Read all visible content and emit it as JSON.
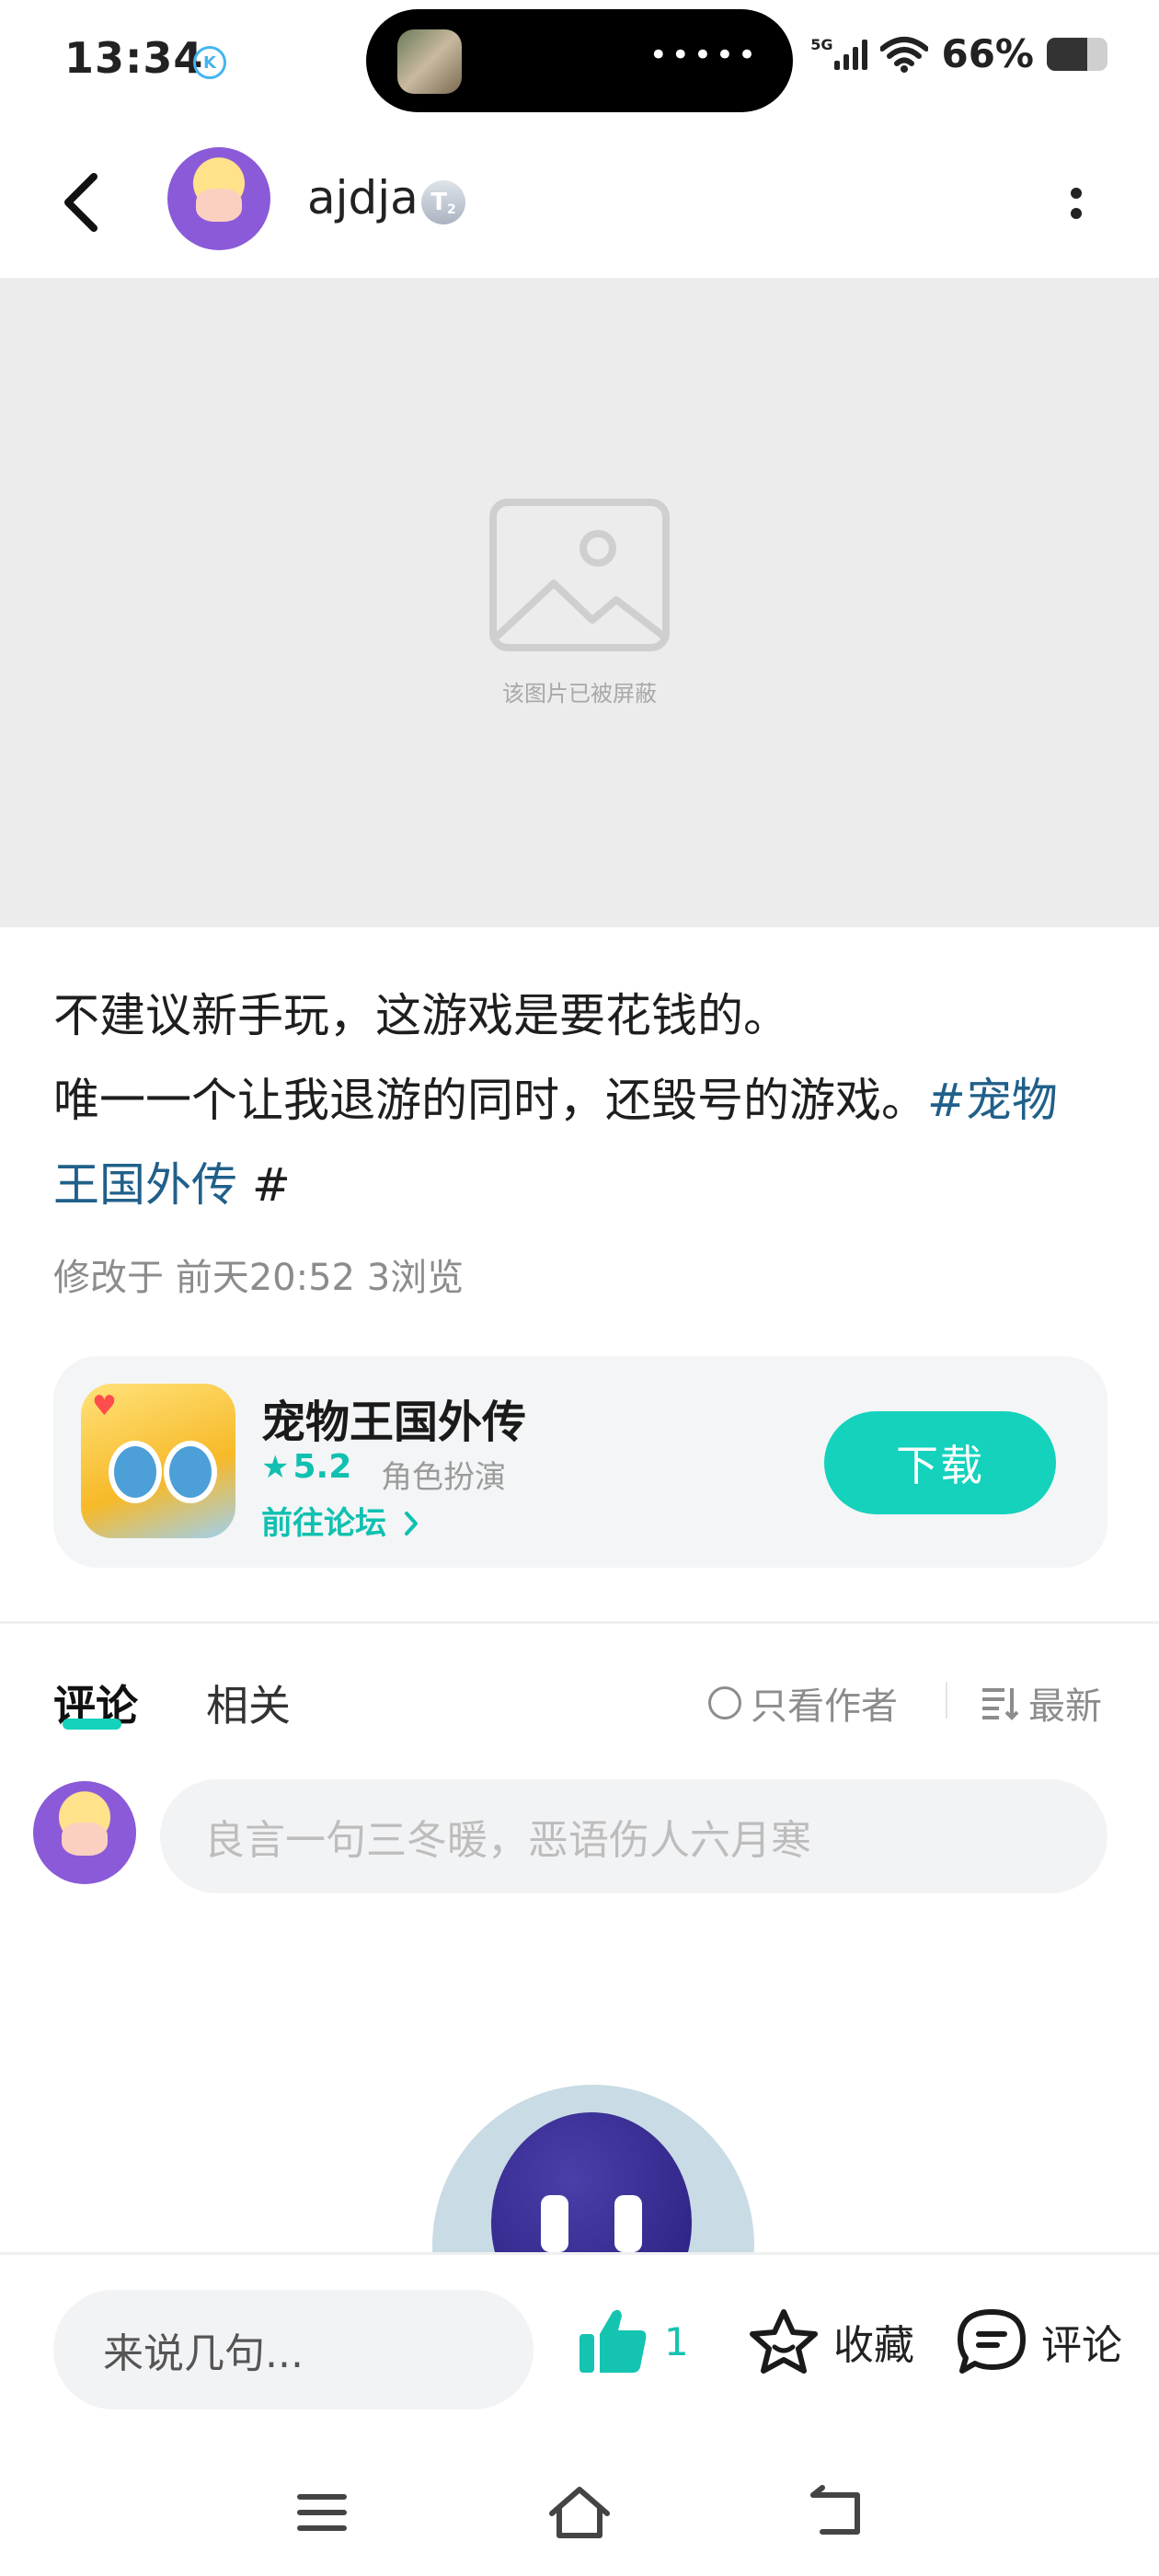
{
  "status_bar": {
    "time": "13:34",
    "k_badge": "K",
    "network": "5G",
    "battery_percent_text": "66%",
    "battery_level": 0.66
  },
  "header": {
    "author_name": "ajdja",
    "level_badge": "T",
    "level_sub": "2"
  },
  "image": {
    "caption": "该图片已被屏蔽"
  },
  "post": {
    "line1": "不建议新手玩，这游戏是要花钱的。",
    "line2_text": "唯一一个让我退游的同时，还毁号的游戏。",
    "line2_topic": "#宠物",
    "line3_topic": "王国外传",
    "line3_hash": " #",
    "meta": "修改于 前天20:52  3浏览"
  },
  "game_card": {
    "title": "宠物王国外传",
    "rating": "5.2",
    "genre": "角色扮演",
    "forum_link": "前往论坛",
    "download_label": "下载"
  },
  "tabs": {
    "comments": "评论",
    "related": "相关",
    "author_only": "只看作者",
    "sort": "最新"
  },
  "comment_box": {
    "placeholder": "良言一句三冬暖，恶语伤人六月寒"
  },
  "bottom_bar": {
    "quick_input_placeholder": "来说几句...",
    "like_count": "1",
    "favorite_label": "收藏",
    "comment_label": "评论"
  },
  "colors": {
    "accent": "#14d2bc",
    "topic_link": "#20608a"
  }
}
